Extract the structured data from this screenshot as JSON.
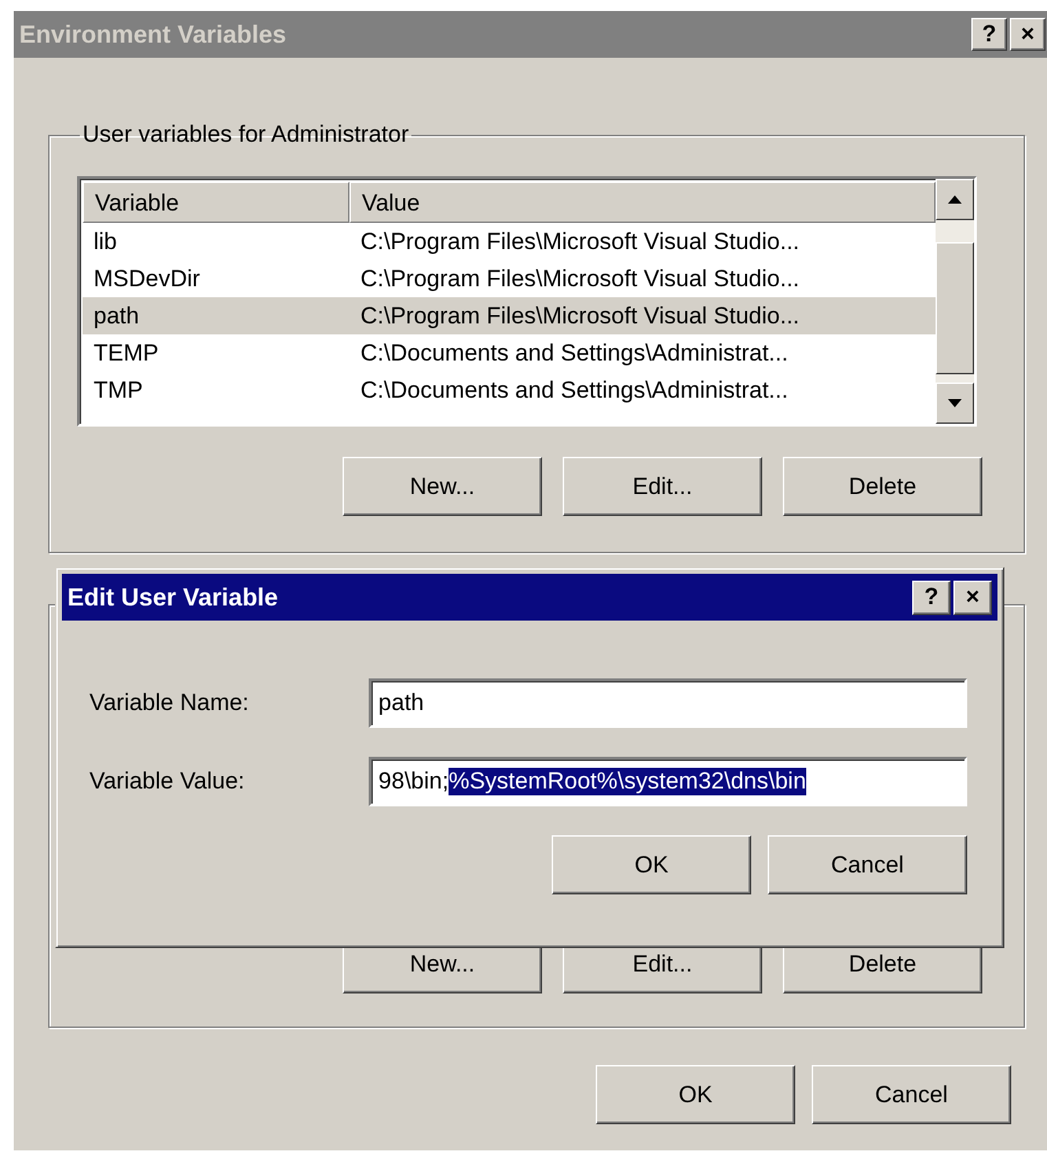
{
  "main_window": {
    "title": "Environment Variables",
    "active": false,
    "title_buttons": [
      "?",
      "×"
    ],
    "user_group": {
      "label": "User variables for Administrator",
      "table": {
        "columns": [
          "Variable",
          "Value"
        ],
        "rows": [
          {
            "cells": [
              "lib",
              "C:\\Program Files\\Microsoft Visual Studio..."
            ],
            "selected": false
          },
          {
            "cells": [
              "MSDevDir",
              "C:\\Program Files\\Microsoft Visual Studio..."
            ],
            "selected": false
          },
          {
            "cells": [
              "path",
              "C:\\Program Files\\Microsoft Visual Studio..."
            ],
            "selected": true
          },
          {
            "cells": [
              "TEMP",
              "C:\\Documents and Settings\\Administrat..."
            ],
            "selected": false
          },
          {
            "cells": [
              "TMP",
              "C:\\Documents and Settings\\Administrat..."
            ],
            "selected": false
          }
        ]
      },
      "buttons": [
        "New...",
        "Edit...",
        "Delete"
      ]
    },
    "system_group": {
      "buttons": [
        "New...",
        "Edit...",
        "Delete"
      ]
    },
    "buttons": [
      "OK",
      "Cancel"
    ]
  },
  "edit_dialog": {
    "title": "Edit User Variable",
    "active": true,
    "title_buttons": [
      "?",
      "×"
    ],
    "fields": [
      {
        "label": "Variable Name:",
        "value": "path"
      },
      {
        "label": "Variable Value:",
        "value": "98\\bin;",
        "selected_value": "%SystemRoot%\\system32\\dns\\bin"
      }
    ],
    "buttons": [
      "OK",
      "Cancel"
    ]
  }
}
